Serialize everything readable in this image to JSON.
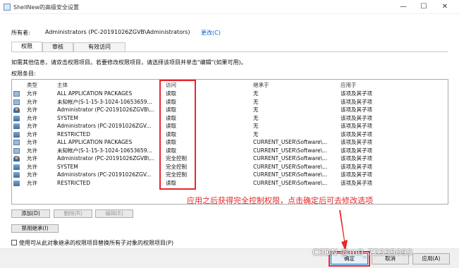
{
  "window": {
    "title": "ShellNew的高级安全设置",
    "minimize_glyph": "—",
    "maximize_glyph": "☐",
    "close_glyph": "✕"
  },
  "owner": {
    "label": "所有者:",
    "value": "Administrators (PC-20191026ZGVB\\Administrators)",
    "change_link": "更改(C)"
  },
  "tabs": [
    {
      "label": "权限",
      "active": true
    },
    {
      "label": "审核",
      "active": false
    },
    {
      "label": "有效访问",
      "active": false
    }
  ],
  "info_text": "如需其他信息，请双击权限项目。若要修改权限项目，请选择该项目并单击\"编辑\"(如果可用)。",
  "permissions_label": "权限条目:",
  "table": {
    "headers": [
      "类型",
      "主体",
      "访问",
      "继承于",
      "应用于"
    ],
    "rows": [
      {
        "icon": "package-icon",
        "type": "允许",
        "principal": "ALL APPLICATION PACKAGES",
        "access": "读取",
        "inherited": "无",
        "applies": "该项及其子项"
      },
      {
        "icon": "package-icon",
        "type": "允许",
        "principal": "未知帐户(S-1-15-3-1024-10653659...",
        "access": "读取",
        "inherited": "无",
        "applies": "该项及其子项"
      },
      {
        "icon": "user-icon",
        "type": "允许",
        "principal": "Administrator (PC-20191026ZGVB\\...",
        "access": "读取",
        "inherited": "无",
        "applies": "该项及其子项"
      },
      {
        "icon": "group-icon",
        "type": "允许",
        "principal": "SYSTEM",
        "access": "读取",
        "inherited": "无",
        "applies": "该项及其子项"
      },
      {
        "icon": "group-icon",
        "type": "允许",
        "principal": "Administrators (PC-20191026ZGV...",
        "access": "读取",
        "inherited": "无",
        "applies": "该项及其子项"
      },
      {
        "icon": "group-icon",
        "type": "允许",
        "principal": "RESTRICTED",
        "access": "读取",
        "inherited": "无",
        "applies": "该项及其子项"
      },
      {
        "icon": "package-icon",
        "type": "允许",
        "principal": "ALL APPLICATION PACKAGES",
        "access": "读取",
        "inherited": "CURRENT_USER\\Software\\...",
        "applies": "该项及其子项"
      },
      {
        "icon": "package-icon",
        "type": "允许",
        "principal": "未知帐户(S-1-15-3-1024-10653659...",
        "access": "读取",
        "inherited": "CURRENT_USER\\Software\\...",
        "applies": "该项及其子项"
      },
      {
        "icon": "user-icon",
        "type": "允许",
        "principal": "Administrator (PC-20191026ZGVB\\...",
        "access": "完全控制",
        "inherited": "CURRENT_USER\\Software\\...",
        "applies": "该项及其子项"
      },
      {
        "icon": "group-icon",
        "type": "允许",
        "principal": "SYSTEM",
        "access": "完全控制",
        "inherited": "CURRENT_USER\\Software\\...",
        "applies": "该项及其子项"
      },
      {
        "icon": "group-icon",
        "type": "允许",
        "principal": "Administrators (PC-20191026ZGV...",
        "access": "完全控制",
        "inherited": "CURRENT_USER\\Software\\...",
        "applies": "该项及其子项"
      },
      {
        "icon": "group-icon",
        "type": "允许",
        "principal": "RESTRICTED",
        "access": "读取",
        "inherited": "CURRENT_USER\\Software\\...",
        "applies": "该项及其子项"
      }
    ]
  },
  "buttons": {
    "add": "添加(D)",
    "remove": "删除(R)",
    "edit": "编辑(E)",
    "disable_inheritance": "禁用继承(I)",
    "ok": "确定",
    "cancel": "取消",
    "apply": "应用(A)"
  },
  "replace_checkbox_label": "使用可从此对象继承的权限项目替换所有子对象的权限项目(P)",
  "annotation": "应用之后获得完全控制权限，点击确定后可去修改选项",
  "watermark": "CSDN @m0_72335093",
  "colors": {
    "annotation_red": "#e8262a",
    "link_blue": "#0066cc",
    "accent": "#0078d7"
  }
}
